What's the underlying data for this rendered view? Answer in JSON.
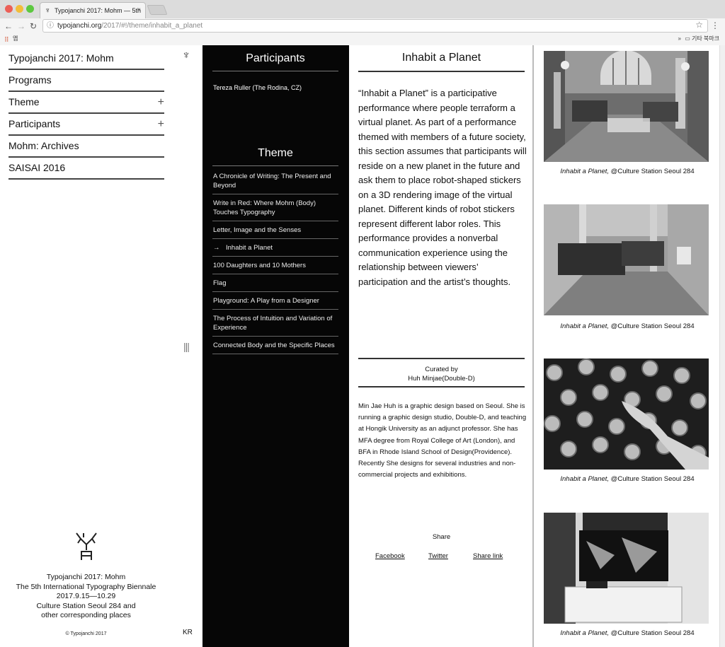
{
  "browser": {
    "tab_title": "Typojanchi 2017: Mohm — 5th",
    "tab_close": "×",
    "url_domain": "typojanchi.org",
    "url_path": "/2017/#!/theme/inhabit_a_planet",
    "apps_label": "앱",
    "bookmarks_chevron": "»",
    "bookmark_folder": "기타 북마크"
  },
  "nav": {
    "items": [
      {
        "label": "Typojanchi 2017: Mohm"
      },
      {
        "label": "Programs"
      },
      {
        "label": "Theme",
        "expand": "+"
      },
      {
        "label": "Participants",
        "expand": "+"
      },
      {
        "label": "Mohm: Archives"
      },
      {
        "label": "SAISAI 2016"
      }
    ],
    "menu_toggle": "|||",
    "footer": {
      "line1": "Typojanchi 2017: Mohm",
      "line2": "The 5th International Typography Biennale",
      "line3": "2017.9.15—10.29",
      "line4": "Culture Station Seoul 284 and",
      "line5": "other corresponding places",
      "copyright": "© Typojanchi 2017",
      "lang": "KR"
    }
  },
  "sidebar": {
    "participants_heading": "Participants",
    "participant": "Tereza Ruller (The Rodina, CZ)",
    "theme_heading": "Theme",
    "themes": [
      {
        "label": "A Chronicle of Writing: The Present and Beyond"
      },
      {
        "label": "Write in Red: Where Mohm (Body) Touches Typography"
      },
      {
        "label": "Letter, Image and the Senses"
      },
      {
        "label": "Inhabit a Planet",
        "marker": "→"
      },
      {
        "label": "100 Daughters and 10 Mothers"
      },
      {
        "label": "Flag"
      },
      {
        "label": "Playground: A Play from a Designer"
      },
      {
        "label": "The Process of Intuition and Variation of Experience"
      },
      {
        "label": "Connected Body and the Specific Places"
      }
    ]
  },
  "article": {
    "title": "Inhabit a Planet",
    "body": "“Inhabit a Planet” is a participative performance where people terraform a virtual planet. As part of a performance themed with members of a future society, this section assumes that participants will reside on a new planet in the future and ask them to place robot-shaped stickers on a 3D rendering image of the virtual planet. Different kinds of robot stickers represent different labor roles. This performance provides a nonverbal communication experience using the relationship between viewers’ participation and the artist’s thoughts.",
    "curated_by": "Curated by",
    "curator": "Huh Minjae(Double-D)",
    "bio": "Min Jae Huh is a graphic design based on Seoul. She is running a graphic design studio, Double-D, and teaching at Hongik University as an adjunct professor. She has MFA degree from Royal College of Art (London), and BFA in Rhode Island School of Design(Providence). Recently She designs for several industries and non-commercial projects and exhibitions.",
    "share_label": "Share",
    "share_facebook": "Facebook",
    "share_twitter": "Twitter",
    "share_link": "Share link"
  },
  "gallery": {
    "caption_title": "Inhabit a Planet,",
    "caption_place": " @Culture Station Seoul 284",
    "photos": [
      {
        "icon": "exhibition-hall-photo"
      },
      {
        "icon": "exhibition-installation-photo"
      },
      {
        "icon": "robot-stickers-closeup-photo"
      },
      {
        "icon": "screen-display-photo"
      }
    ]
  }
}
